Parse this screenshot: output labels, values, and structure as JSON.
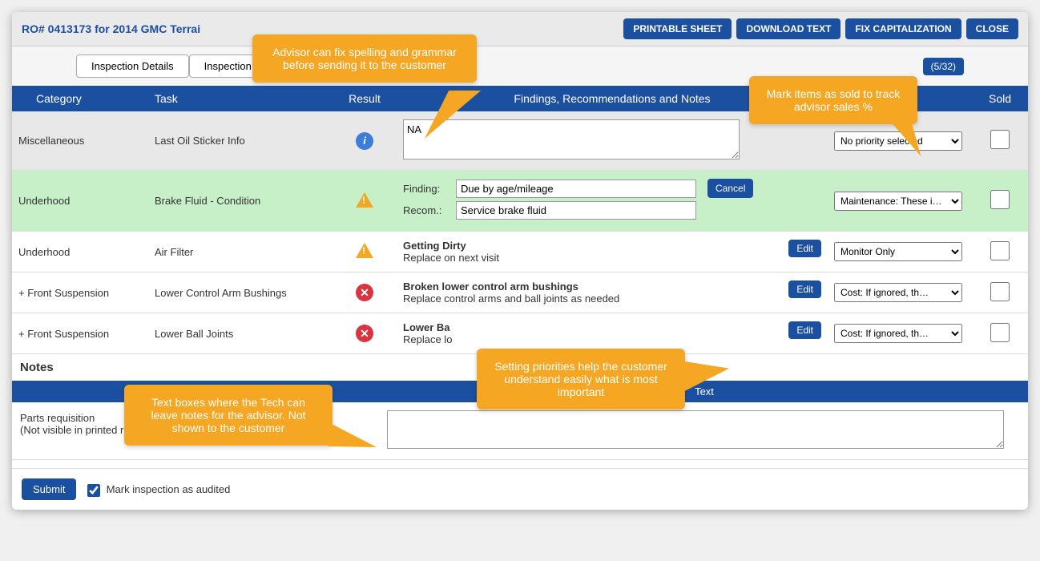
{
  "header": {
    "ro_title": "RO# 0413173 for 2014 GMC Terrai",
    "buttons": {
      "printable": "PRINTABLE SHEET",
      "download": "DOWNLOAD TEXT",
      "fixcap": "FIX CAPITALIZATION",
      "close": "CLOSE"
    }
  },
  "tabs": {
    "details": "Inspection Details",
    "events": "Inspection Events",
    "count": "(5/32)"
  },
  "columns": {
    "category": "Category",
    "task": "Task",
    "result": "Result",
    "findings": "Findings, Recommendations and Notes",
    "sold": "Sold"
  },
  "rows": [
    {
      "category": "Miscellaneous",
      "task": "Last Oil Sticker Info",
      "icon": "info",
      "finding_text": "NA",
      "priority": "No priority selected",
      "mode": "textarea",
      "rowclass": "row-gray"
    },
    {
      "category": "Underhood",
      "task": "Brake Fluid - Condition",
      "icon": "warn",
      "finding_label": "Finding:",
      "recom_label": "Recom.:",
      "finding_val": "Due by age/mileage",
      "recom_val": "Service brake fluid",
      "cancel": "Cancel",
      "priority": "Maintenance: These i…",
      "mode": "editing",
      "rowclass": "row-green"
    },
    {
      "category": "Underhood",
      "task": "Air Filter",
      "icon": "warn",
      "finding_bold": "Getting Dirty",
      "finding_sub": "Replace on next visit",
      "edit": "Edit",
      "priority": "Monitor Only",
      "mode": "display",
      "rowclass": ""
    },
    {
      "category": "+ Front Suspension",
      "task": "Lower Control Arm Bushings",
      "icon": "fail",
      "finding_bold": "Broken lower control arm bushings",
      "finding_sub": "Replace control arms and ball joints as needed",
      "edit": "Edit",
      "priority": "Cost: If ignored, th…",
      "mode": "display",
      "rowclass": ""
    },
    {
      "category": "+ Front Suspension",
      "task": "Lower Ball Joints",
      "icon": "fail",
      "finding_bold": "Lower Ba",
      "finding_sub": "Replace lo",
      "edit": "Edit",
      "priority": "Cost: If ignored, th…",
      "mode": "display",
      "rowclass": ""
    }
  ],
  "notes": {
    "header": "Notes",
    "text_col": "Text",
    "label_line1": "Parts requisition",
    "label_line2": "(Not visible in printed reports)"
  },
  "footer": {
    "submit": "Submit",
    "audit_label": "Mark inspection as audited"
  },
  "callouts": {
    "c1": "Advisor can fix spelling and grammar before sending it to the customer",
    "c2": "Mark items as sold to track advisor sales %",
    "c3": "Setting priorities help the customer understand easily what is most important",
    "c4": "Text boxes where the Tech can leave notes for the advisor. Not shown to the customer"
  }
}
